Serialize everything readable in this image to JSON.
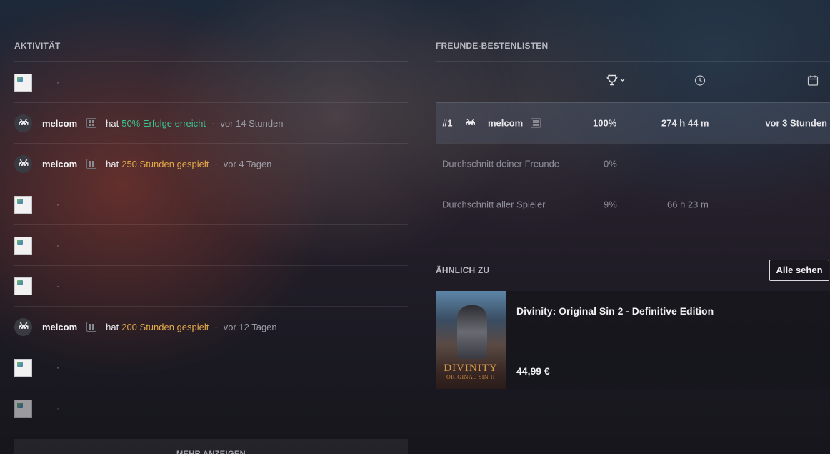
{
  "activity": {
    "title": "AKTIVITÄT",
    "rows": [
      {
        "type": "broken",
        "dot": "·"
      },
      {
        "type": "event",
        "user": "melcom",
        "verb": "hat",
        "highlight": "50% Erfolge erreicht",
        "highlight_color": "#3dc28f",
        "sep": "·",
        "when": "vor 14 Stunden"
      },
      {
        "type": "event",
        "user": "melcom",
        "verb": "hat",
        "highlight": "250 Stunden gespielt",
        "highlight_color": "#e3a94b",
        "sep": "·",
        "when": "vor 4 Tagen"
      },
      {
        "type": "broken",
        "dot": "·"
      },
      {
        "type": "broken",
        "dot": "·"
      },
      {
        "type": "broken",
        "dot": "·"
      },
      {
        "type": "event",
        "user": "melcom",
        "verb": "hat",
        "highlight": "200 Stunden gespielt",
        "highlight_color": "#e3a94b",
        "sep": "·",
        "when": "vor 12 Tagen"
      },
      {
        "type": "broken",
        "dot": "·"
      },
      {
        "type": "broken",
        "dot": "·"
      }
    ],
    "more_label": "MEHR ANZEIGEN"
  },
  "leaderboard": {
    "title": "FREUNDE-BESTENLISTEN",
    "columns": {
      "achievements": "trophy-icon",
      "playtime": "clock-icon",
      "last_played": "calendar-icon"
    },
    "me": {
      "rank": "#1",
      "user": "melcom",
      "achievements": "100%",
      "playtime": "274 h 44 m",
      "last_played": "vor 3 Stunden"
    },
    "friends_avg": {
      "label": "Durchschnitt deiner Freunde",
      "achievements": "0%"
    },
    "all_avg": {
      "label": "Durchschnitt aller Spieler",
      "achievements": "9%",
      "playtime": "66 h 23 m"
    }
  },
  "similar": {
    "title": "ÄHNLICH ZU",
    "see_all": "Alle sehen",
    "game": {
      "title": "Divinity: Original Sin 2 - Definitive Edition",
      "price": "44,99 €",
      "cover_logo": "DIVINITY",
      "cover_sub": "ORIGINAL SIN II"
    }
  },
  "colors": {
    "accent_green": "#3dc28f",
    "accent_gold": "#e3a94b"
  }
}
